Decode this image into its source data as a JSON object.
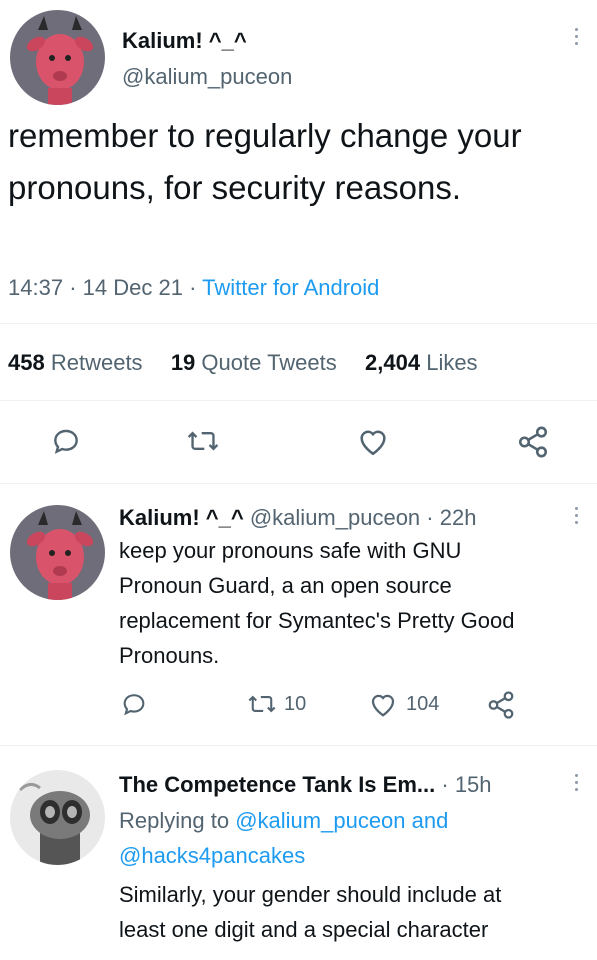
{
  "main_tweet": {
    "author_name": "Kalium! ^_^",
    "author_handle": "@kalium_puceon",
    "text": "remember to regularly change your pronouns, for security reasons.",
    "time": "14:37",
    "date": "14 Dec 21",
    "client": "Twitter for Android",
    "retweets_count": "458",
    "retweets_label": "Retweets",
    "quotes_count": "19",
    "quotes_label": "Quote Tweets",
    "likes_count": "2,404",
    "likes_label": "Likes"
  },
  "reply1": {
    "author_name": "Kalium! ^_^",
    "author_handle": "@kalium_puceon",
    "age": "22h",
    "text_lines": [
      "keep your pronouns safe with GNU",
      "Pronoun Guard, a an open source",
      "replacement for Symantec's Pretty Good",
      "Pronouns."
    ],
    "retweets": "10",
    "likes": "104"
  },
  "reply2": {
    "author_name": "The Competence Tank Is Em...",
    "age": "15h",
    "replying_prefix": "Replying to",
    "mention1": "@kalium_puceon",
    "joiner": "and",
    "mention2": "@hacks4pancakes",
    "text_lines": [
      "Similarly, your gender should include at",
      "least one digit and a special character"
    ]
  },
  "colors": {
    "accent": "#1d9bf0",
    "secondary_text": "#536471",
    "avatar_bg": "#6b6b78",
    "deer_pink": "#d9536a"
  },
  "icons": [
    "kebab-menu-icon",
    "reply-icon",
    "retweet-icon",
    "like-icon",
    "share-icon"
  ]
}
